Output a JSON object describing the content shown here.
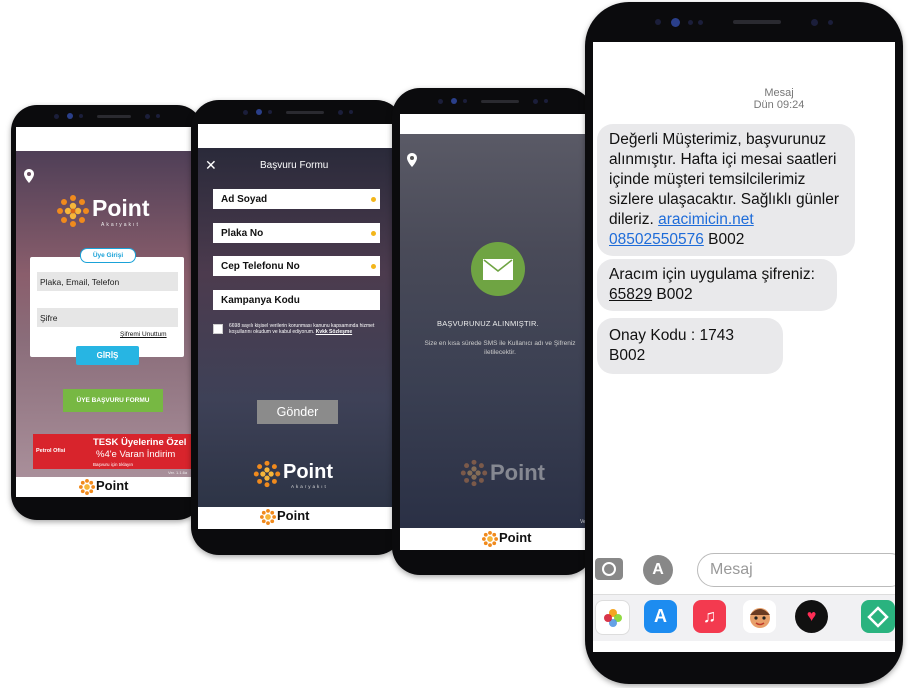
{
  "phone1": {
    "logo_word": "Point",
    "logo_sub": "Akaryakıt",
    "login_title": "Üye Girişi",
    "username_placeholder": "Plaka, Email, Telefon",
    "password_placeholder": "Şifre",
    "forgot_label": "Şifremi Unuttum",
    "login_button": "GİRİŞ",
    "apply_button": "ÜYE BAŞVURU FORMU",
    "banner_brand": "Petrol Ofisi",
    "banner_line1": "TESK Üyelerine Özel",
    "banner_line2": "%4'e Varan İndirim",
    "banner_note": "Başvuru için tıklayın",
    "version": "Ver. 1.1.6a",
    "footer_logo": "Point"
  },
  "phone2": {
    "title": "Başvuru Formu",
    "close_icon": "close-icon",
    "fields": [
      "Ad Soyad",
      "Plaka No",
      "Cep Telefonu No",
      "Kampanya Kodu"
    ],
    "consent_text": "6698 sayılı kişisel verilerin korunması kanunu kapsamında hizmet koşullarını okudum ve kabul ediyorum.",
    "consent_link": "Kvkk Sözleşme",
    "submit_button": "Gönder",
    "logo_word": "Point",
    "logo_sub": "Akaryakıt",
    "footer_logo": "Point"
  },
  "phone3": {
    "heading": "BAŞVURUNUZ ALINMIŞTIR.",
    "body": "Size en kısa sürede SMS ile Kullanıcı adı ve Şifreniz iletilecektir.",
    "logo_word": "Point",
    "footer_logo": "Point",
    "version_fragment": "Ve"
  },
  "phone4": {
    "contact": "Mesaj",
    "time": "Dün 09:24",
    "message1_text": "Değerli Müşterimiz, başvurunuz alınmıştır. Hafta içi mesai saatleri içinde müşteri temsilcilerimiz sizlere ulaşacaktır. Sağlıklı günler dileriz.",
    "message1_link": "aracimicin.net",
    "message1_phone": "08502550576",
    "message1_code": "B002",
    "message2_text": "Aracım için uygulama şifreniz:",
    "message2_code": "65829",
    "message2_suffix": "B002",
    "message3_text": "Onay Kodu : 1743 B002",
    "input_placeholder": "Mesaj",
    "app_icons": [
      "photos-icon",
      "app-store-icon",
      "music-icon",
      "memoji-icon",
      "digital-touch-icon",
      "green-app-icon"
    ]
  },
  "colors": {
    "accent_blue": "#1aa2d8",
    "accent_green": "#77b843",
    "banner_red": "#d8242c",
    "logo_orange": "#f08a1d",
    "link_blue": "#1e6cd9"
  }
}
